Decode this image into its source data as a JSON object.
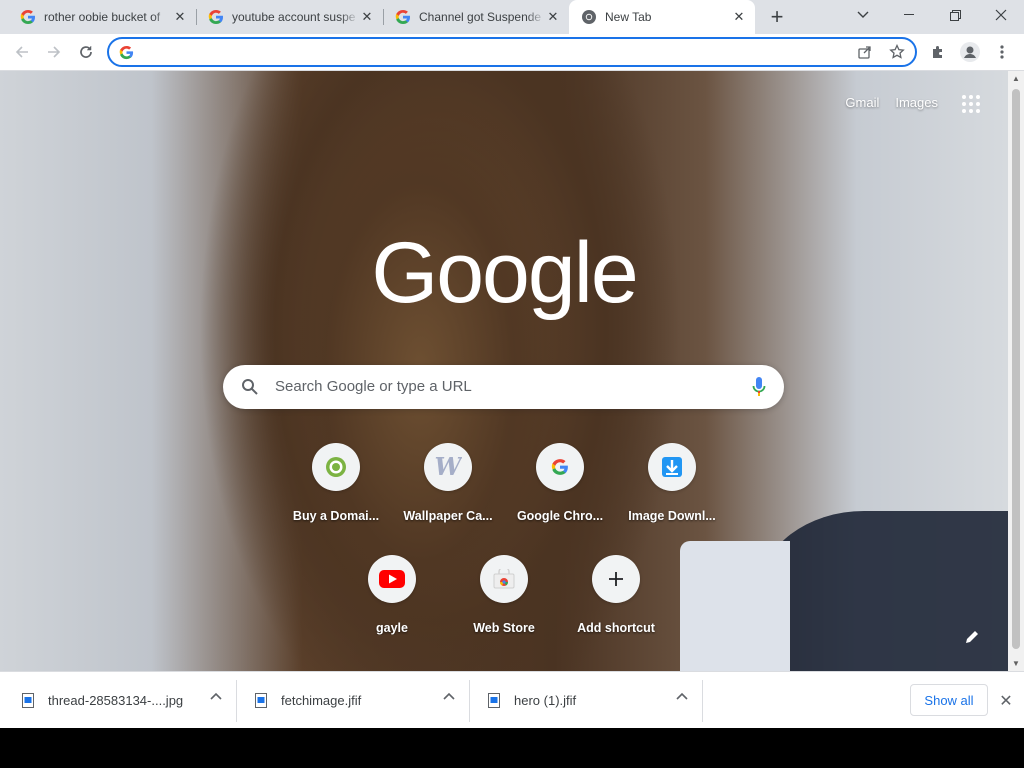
{
  "tabs": [
    {
      "title": "rother oobie bucket of",
      "favicon": "google-g-icon"
    },
    {
      "title": "youtube account suspe",
      "favicon": "google-g-icon"
    },
    {
      "title": "Channel got Suspende",
      "favicon": "google-g-icon"
    },
    {
      "title": "New Tab",
      "favicon": "chrome-icon",
      "active": true
    }
  ],
  "omnibox": {
    "value": "",
    "placeholder": ""
  },
  "ntp": {
    "gmail": "Gmail",
    "images": "Images",
    "search_placeholder": "Search Google or type a URL",
    "shortcuts_row1": [
      {
        "label": "Buy a Domai...",
        "icon": "green-ring-icon"
      },
      {
        "label": "Wallpaper Ca...",
        "icon": "w-letter-icon"
      },
      {
        "label": "Google Chro...",
        "icon": "google-g-icon"
      },
      {
        "label": "Image Downl...",
        "icon": "download-arrow-icon"
      }
    ],
    "shortcuts_row2": [
      {
        "label": "gayle",
        "icon": "youtube-icon"
      },
      {
        "label": "Web Store",
        "icon": "chrome-web-store-icon"
      },
      {
        "label": "Add shortcut",
        "icon": "plus-icon"
      }
    ]
  },
  "downloads": [
    {
      "name": "thread-28583134-....jpg"
    },
    {
      "name": "fetchimage.jfif"
    },
    {
      "name": "hero (1).jfif"
    }
  ],
  "shelf": {
    "show_all": "Show all"
  },
  "colors": {
    "accent": "#1a73e8",
    "tabstrip": "#dee1e6"
  }
}
